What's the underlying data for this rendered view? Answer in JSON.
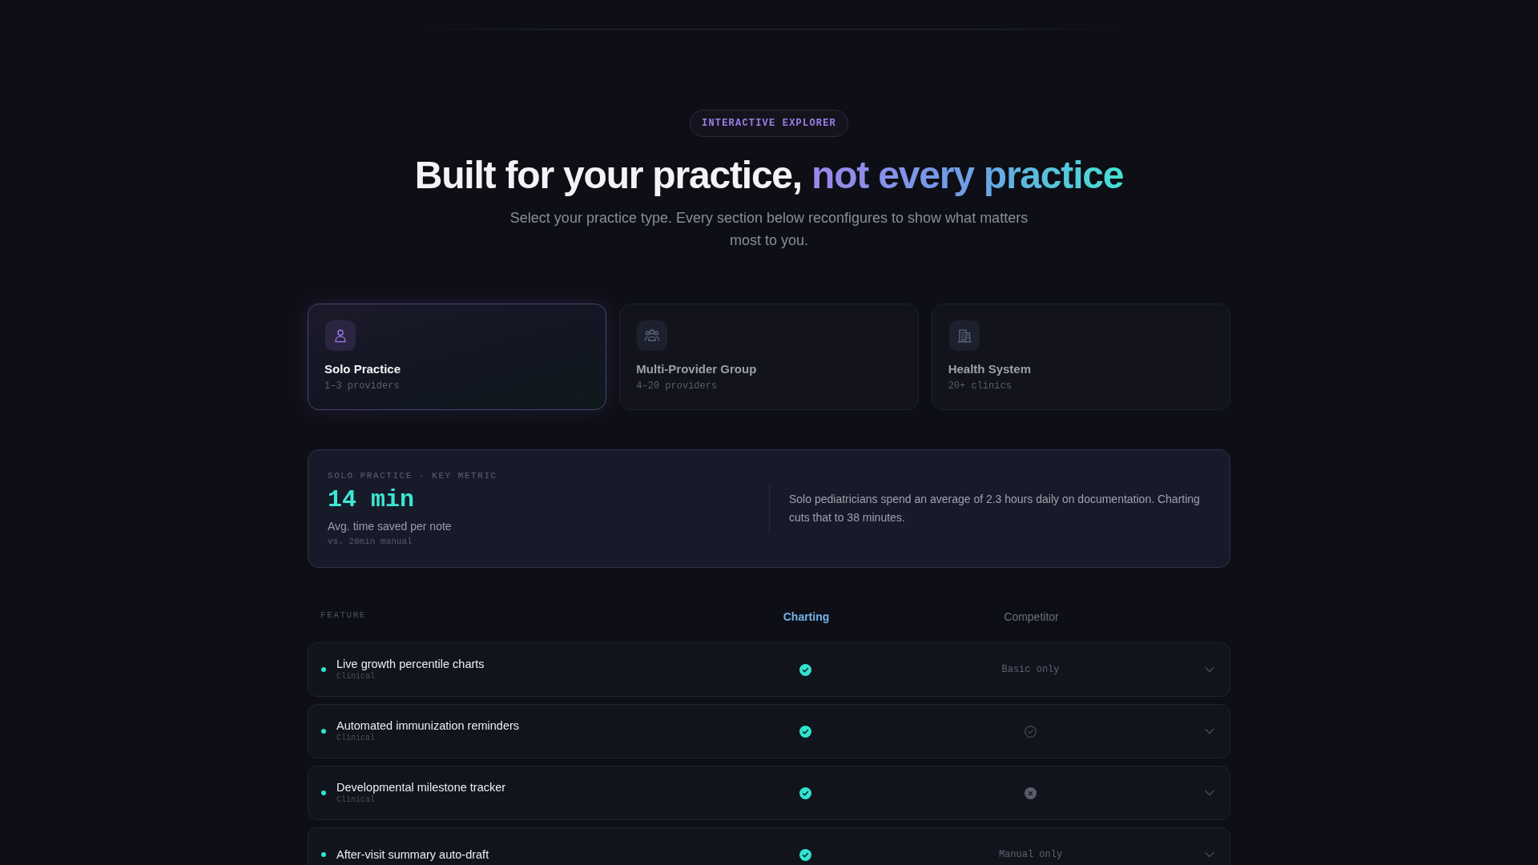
{
  "badge": "INTERACTIVE EXPLORER",
  "heading": {
    "text": "Built for your practice,",
    "highlight": "not every practice"
  },
  "subtitle": "Select your practice type. Every section below reconfigures to show what matters most to you.",
  "practice_types": [
    {
      "kind": "solo",
      "title": "Solo Practice",
      "detail": "1–3 providers",
      "selected": true
    },
    {
      "kind": "group",
      "title": "Multi-Provider Group",
      "detail": "4–20 providers",
      "selected": false
    },
    {
      "kind": "system",
      "title": "Health System",
      "detail": "20+ clinics",
      "selected": false
    }
  ],
  "metric": {
    "label": "SOLO PRACTICE · KEY METRIC",
    "value": "14 min",
    "caption": "Avg. time saved per note",
    "comparison": "vs. 28min manual",
    "description": "Solo pediatricians spend an average of 2.3 hours daily on documentation. Charting cuts that to 38 minutes."
  },
  "comparison": {
    "columns": [
      {
        "kind": "feature",
        "label": "FEATURE"
      },
      {
        "kind": "product",
        "label": "Charting"
      },
      {
        "kind": "competitor",
        "label": "Competitor"
      }
    ],
    "rows": [
      {
        "feature": "Live growth percentile charts",
        "category": "Clinical",
        "charting": {
          "kind": "included"
        },
        "competitor": {
          "kind": "note",
          "text": "Basic only"
        },
        "expanded": false
      },
      {
        "feature": "Automated immunization reminders",
        "category": "Clinical",
        "charting": {
          "kind": "included"
        },
        "competitor": {
          "kind": "partial"
        },
        "expanded": false
      },
      {
        "feature": "Developmental milestone tracker",
        "category": "Clinical",
        "charting": {
          "kind": "included"
        },
        "competitor": {
          "kind": "excluded"
        },
        "expanded": false
      },
      {
        "feature": "After-visit summary auto-draft",
        "charting": {
          "kind": "included"
        },
        "competitor": {
          "kind": "note",
          "text": "Manual only"
        },
        "expanded": false
      }
    ]
  }
}
